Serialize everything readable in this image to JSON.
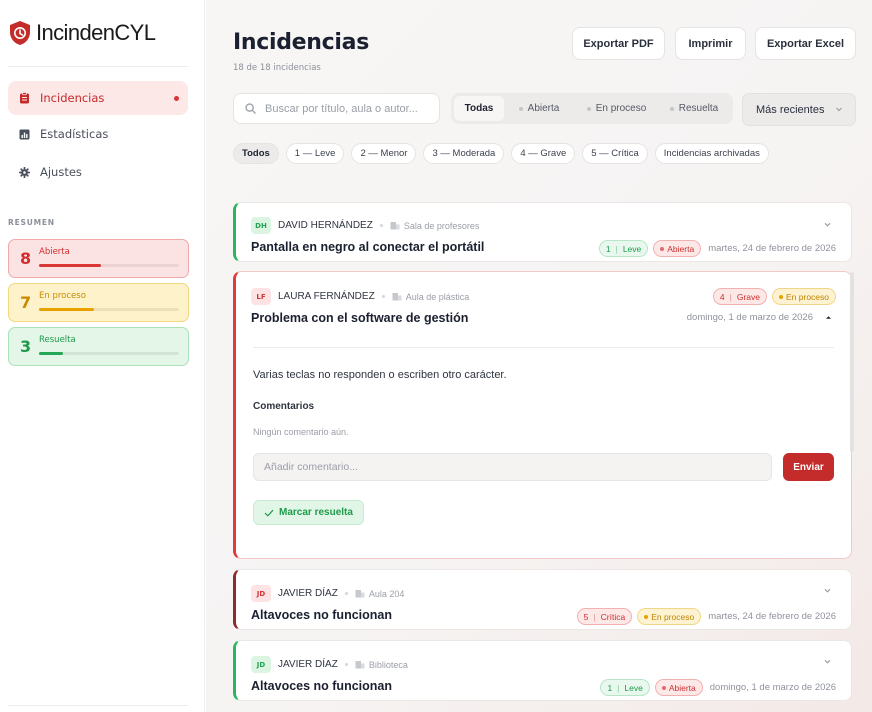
{
  "app": {
    "name": "IncindenCYL"
  },
  "sidebar": {
    "nav": [
      {
        "label": "Incidencias",
        "icon": "clipboard-icon",
        "active": true
      },
      {
        "label": "Estadísticas",
        "icon": "bar-chart-icon",
        "active": false
      },
      {
        "label": "Ajustes",
        "icon": "gear-icon",
        "active": false
      }
    ],
    "summary_heading": "RESUMEN",
    "summary": [
      {
        "count": "8",
        "label": "Abierta",
        "fraction": 0.44,
        "color": "#d93636"
      },
      {
        "count": "7",
        "label": "En proceso",
        "fraction": 0.39,
        "color": "#e9a100"
      },
      {
        "count": "3",
        "label": "Resuelta",
        "fraction": 0.17,
        "color": "#25a855"
      }
    ]
  },
  "header": {
    "title": "Incidencias",
    "count_text": "18 de 18 incidencias",
    "export_pdf": "Exportar PDF",
    "print": "Imprimir",
    "export_excel": "Exportar Excel"
  },
  "filters": {
    "search_placeholder": "Buscar por título, aula o autor...",
    "status_tabs": [
      {
        "label": "Todas",
        "active": true
      },
      {
        "label": "Abierta",
        "active": false
      },
      {
        "label": "En proceso",
        "active": false
      },
      {
        "label": "Resuelta",
        "active": false
      }
    ],
    "sort_value": "Más recientes",
    "severity_chips": [
      {
        "label": "Todos",
        "active": true
      },
      {
        "label": "1 — Leve",
        "active": false
      },
      {
        "label": "2 — Menor",
        "active": false
      },
      {
        "label": "3 — Moderada",
        "active": false
      },
      {
        "label": "4 — Grave",
        "active": false
      },
      {
        "label": "5 — Crítica",
        "active": false
      },
      {
        "label": "Incidencias archivadas",
        "active": false
      }
    ]
  },
  "incidents": [
    {
      "initials": "DH",
      "author": "DAVID HERNÁNDEZ",
      "room": "Sala de profesores",
      "title": "Pantalla en negro al conectar el portátil",
      "severity_num": "1",
      "severity_label": "Leve",
      "status": "Abierta",
      "date": "martes, 24 de febrero de 2026"
    },
    {
      "initials": "LF",
      "author": "LAURA FERNÁNDEZ",
      "room": "Aula de plástica",
      "title": "Problema con el software de gestión",
      "severity_num": "4",
      "severity_label": "Grave",
      "status": "En proceso",
      "date": "domingo, 1 de marzo de 2026",
      "description": "Varias teclas no responden o escriben otro carácter.",
      "comments_heading": "Comentarios",
      "no_comments": "Ningún comentario aún.",
      "comment_placeholder": "Añadir comentario...",
      "send_label": "Enviar",
      "resolve_label": "Marcar resuelta"
    },
    {
      "initials": "JD",
      "author": "JAVIER DÍAZ",
      "room": "Aula 204",
      "title": "Altavoces no funcionan",
      "severity_num": "5",
      "severity_label": "Crítica",
      "status": "En proceso",
      "date": "martes, 24 de febrero de 2026"
    },
    {
      "initials": "JD",
      "author": "JAVIER DÍAZ",
      "room": "Biblioteca",
      "title": "Altavoces no funcionan",
      "severity_num": "1",
      "severity_label": "Leve",
      "status": "Abierta",
      "date": "domingo, 1 de marzo de 2026"
    }
  ]
}
